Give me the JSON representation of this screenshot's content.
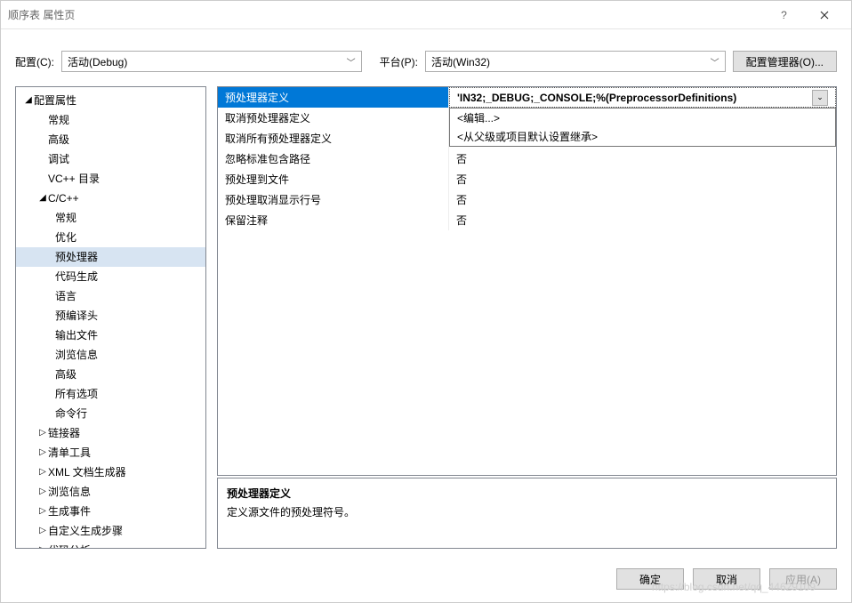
{
  "titlebar": {
    "title": "顺序表 属性页"
  },
  "config": {
    "config_label": "配置(C):",
    "config_value": "活动(Debug)",
    "platform_label": "平台(P):",
    "platform_value": "活动(Win32)",
    "manager_button": "配置管理器(O)..."
  },
  "tree": {
    "root": "配置属性",
    "items1": [
      "常规",
      "高级",
      "调试",
      "VC++ 目录"
    ],
    "cpp": "C/C++",
    "cpp_children": [
      "常规",
      "优化",
      "预处理器",
      "代码生成",
      "语言",
      "预编译头",
      "输出文件",
      "浏览信息",
      "高级",
      "所有选项",
      "命令行"
    ],
    "cpp_selected_index": 2,
    "items2": [
      "链接器",
      "清单工具",
      "XML 文档生成器",
      "浏览信息",
      "生成事件",
      "自定义生成步骤",
      "代码分析"
    ]
  },
  "props": [
    {
      "name": "预处理器定义",
      "value": "'IN32;_DEBUG;_CONSOLE;%(PreprocessorDefinitions)",
      "selected": true
    },
    {
      "name": "取消预处理器定义",
      "value": ""
    },
    {
      "name": "取消所有预处理器定义",
      "value": ""
    },
    {
      "name": "忽略标准包含路径",
      "value": "否"
    },
    {
      "name": "预处理到文件",
      "value": "否"
    },
    {
      "name": "预处理取消显示行号",
      "value": "否"
    },
    {
      "name": "保留注释",
      "value": "否"
    }
  ],
  "dropdown": {
    "items": [
      "<编辑...>",
      "<从父级或项目默认设置继承>"
    ]
  },
  "desc": {
    "title": "预处理器定义",
    "text": "定义源文件的预处理符号。"
  },
  "buttons": {
    "ok": "确定",
    "cancel": "取消",
    "apply": "应用(A)"
  },
  "watermark": "https://blog.csdn.net/qq_44629109"
}
